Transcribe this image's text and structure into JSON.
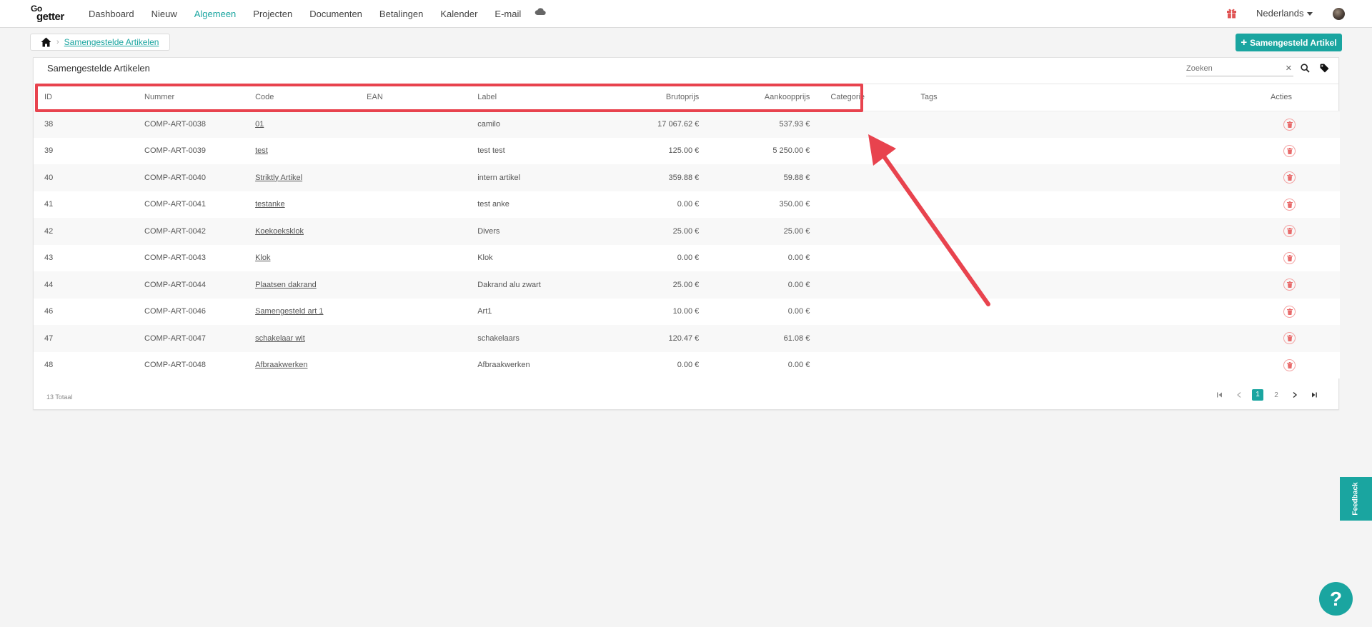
{
  "logo": {
    "line1": "Go",
    "line2": "getter"
  },
  "nav": {
    "items": [
      {
        "label": "Dashboard",
        "active": false
      },
      {
        "label": "Nieuw",
        "active": false
      },
      {
        "label": "Algemeen",
        "active": true
      },
      {
        "label": "Projecten",
        "active": false
      },
      {
        "label": "Documenten",
        "active": false
      },
      {
        "label": "Betalingen",
        "active": false
      },
      {
        "label": "Kalender",
        "active": false
      },
      {
        "label": "E-mail",
        "active": false
      }
    ],
    "language": "Nederlands"
  },
  "breadcrumb": {
    "current": "Samengestelde Artikelen"
  },
  "add_button_label": "Samengesteld Artikel",
  "card": {
    "title": "Samengestelde Artikelen",
    "search_placeholder": "Zoeken",
    "clear_glyph": "✕"
  },
  "table": {
    "headers": {
      "id": "ID",
      "nummer": "Nummer",
      "code": "Code",
      "ean": "EAN",
      "label": "Label",
      "brutoprijs": "Brutoprijs",
      "aankoopprijs": "Aankoopprijs",
      "categorie": "Categorie",
      "tags": "Tags",
      "acties": "Acties"
    },
    "rows": [
      {
        "id": "38",
        "nummer": "COMP-ART-0038",
        "code": "01",
        "ean": "",
        "label": "camilo",
        "brutoprijs": "17 067.62 €",
        "aankoopprijs": "537.93 €",
        "categorie": "",
        "tags": ""
      },
      {
        "id": "39",
        "nummer": "COMP-ART-0039",
        "code": "test",
        "ean": "",
        "label": "test test",
        "brutoprijs": "125.00 €",
        "aankoopprijs": "5 250.00 €",
        "categorie": "",
        "tags": ""
      },
      {
        "id": "40",
        "nummer": "COMP-ART-0040",
        "code": "Striktly Artikel",
        "ean": "",
        "label": "intern artikel",
        "brutoprijs": "359.88 €",
        "aankoopprijs": "59.88 €",
        "categorie": "",
        "tags": ""
      },
      {
        "id": "41",
        "nummer": "COMP-ART-0041",
        "code": "testanke",
        "ean": "",
        "label": "test anke",
        "brutoprijs": "0.00 €",
        "aankoopprijs": "350.00 €",
        "categorie": "",
        "tags": ""
      },
      {
        "id": "42",
        "nummer": "COMP-ART-0042",
        "code": "Koekoeksklok",
        "ean": "",
        "label": "Divers",
        "brutoprijs": "25.00 €",
        "aankoopprijs": "25.00 €",
        "categorie": "",
        "tags": ""
      },
      {
        "id": "43",
        "nummer": "COMP-ART-0043",
        "code": "Klok",
        "ean": "",
        "label": "Klok",
        "brutoprijs": "0.00 €",
        "aankoopprijs": "0.00 €",
        "categorie": "",
        "tags": ""
      },
      {
        "id": "44",
        "nummer": "COMP-ART-0044",
        "code": "Plaatsen dakrand",
        "ean": "",
        "label": "Dakrand alu zwart",
        "brutoprijs": "25.00 €",
        "aankoopprijs": "0.00 €",
        "categorie": "",
        "tags": ""
      },
      {
        "id": "46",
        "nummer": "COMP-ART-0046",
        "code": "Samengesteld art 1",
        "ean": "",
        "label": "Art1",
        "brutoprijs": "10.00 €",
        "aankoopprijs": "0.00 €",
        "categorie": "",
        "tags": ""
      },
      {
        "id": "47",
        "nummer": "COMP-ART-0047",
        "code": "schakelaar wit",
        "ean": "",
        "label": "schakelaars",
        "brutoprijs": "120.47 €",
        "aankoopprijs": "61.08 €",
        "categorie": "",
        "tags": ""
      },
      {
        "id": "48",
        "nummer": "COMP-ART-0048",
        "code": "Afbraakwerken",
        "ean": "",
        "label": "Afbraakwerken",
        "brutoprijs": "0.00 €",
        "aankoopprijs": "0.00 €",
        "categorie": "",
        "tags": ""
      }
    ]
  },
  "footer": {
    "total": "13 Totaal",
    "pages": [
      "1",
      "2"
    ],
    "current_page": "1"
  },
  "feedback_label": "Feedback",
  "help_label": "?",
  "colors": {
    "accent": "#1aa5a0",
    "annotation": "#e8434e",
    "delete": "#f3a3a3",
    "gift": "#e05555"
  }
}
